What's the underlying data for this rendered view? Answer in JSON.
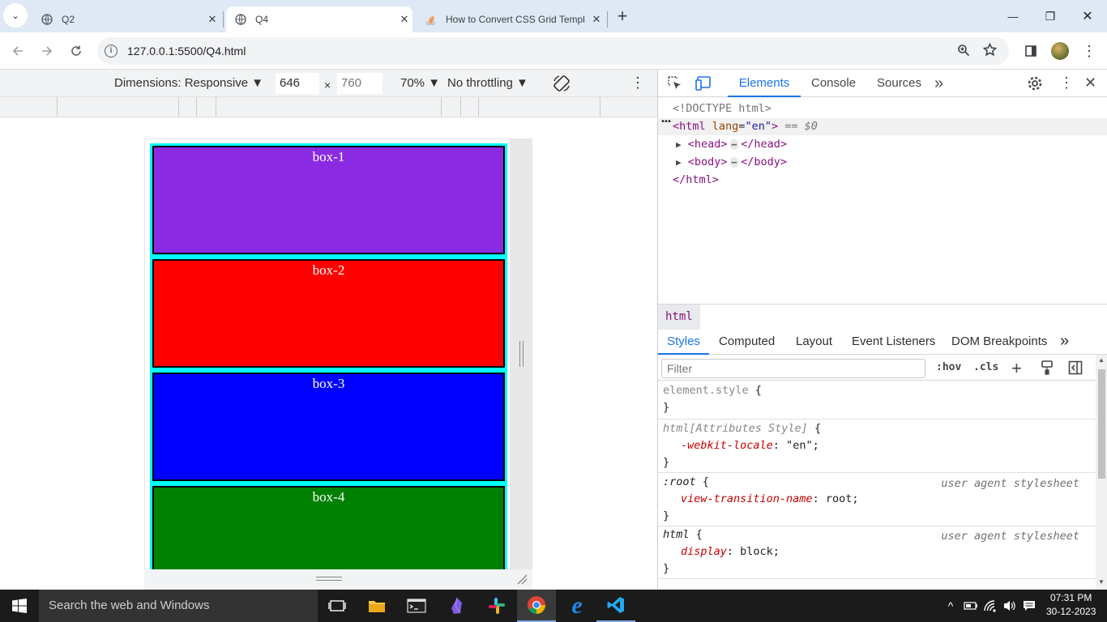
{
  "tabs": [
    {
      "title": "Q2",
      "close": "✕"
    },
    {
      "title": "Q4",
      "close": "✕"
    },
    {
      "title": "How to Convert CSS Grid Templ",
      "close": "✕"
    }
  ],
  "new_tab": "+",
  "window": {
    "minimize": "—",
    "restore": "❐",
    "close": "✕"
  },
  "url": "127.0.0.1:5500/Q4.html",
  "device_toolbar": {
    "dimensions": "Dimensions: Responsive",
    "width": "646",
    "x": "×",
    "height": "760",
    "zoom": "70%",
    "throttling": "No throttling"
  },
  "boxes": [
    {
      "label": "box-1",
      "color": "#8a2be2"
    },
    {
      "label": "box-2",
      "color": "#ff0000"
    },
    {
      "label": "box-3",
      "color": "#0000ff"
    },
    {
      "label": "box-4",
      "color": "#008000"
    }
  ],
  "grid_background": "#00ffff",
  "devtools": {
    "tabs": [
      "Elements",
      "Console",
      "Sources"
    ],
    "more": "»",
    "dom": {
      "doctype": "<!DOCTYPE html>",
      "html_open": "<html",
      "lang_attr": "lang",
      "lang_val": "\"en\"",
      "selected_marker": "== $0",
      "head": "<head>",
      "head_close": "</head>",
      "body": "<body>",
      "body_close": "</body>",
      "html_close": "</html>",
      "ellipsis": "⋯",
      "dots": "•••"
    },
    "breadcrumb": "html",
    "style_tabs": [
      "Styles",
      "Computed",
      "Layout",
      "Event Listeners",
      "DOM Breakpoints"
    ],
    "filter_placeholder": "Filter",
    "hov": ":hov",
    "cls": ".cls",
    "rules": [
      {
        "selector": "element.style",
        "open": " {",
        "decls": [],
        "close": "}",
        "source": ""
      },
      {
        "selector": "html[Attributes Style]",
        "open": " {",
        "decls": [
          {
            "prop": "-webkit-locale",
            "val": "\"en\";"
          }
        ],
        "close": "}",
        "source": ""
      },
      {
        "selector": ":root",
        "open": " {",
        "decls": [
          {
            "prop": "view-transition-name",
            "val": "root;"
          }
        ],
        "close": "}",
        "source": "user agent stylesheet"
      },
      {
        "selector": "html",
        "open": " {",
        "decls": [
          {
            "prop": "display",
            "val": "block;"
          }
        ],
        "close": "}",
        "source": "user agent stylesheet"
      }
    ]
  },
  "taskbar": {
    "search": "Search the web and Windows",
    "time": "07:31 PM",
    "date": "30-12-2023"
  }
}
